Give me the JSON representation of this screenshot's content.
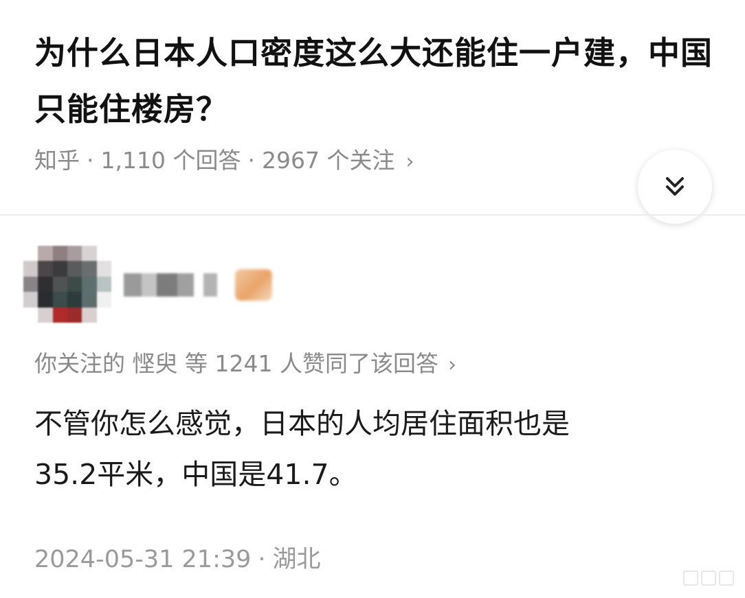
{
  "question": {
    "title": "为什么日本人口密度这么大还能住一户建，中国只能住楼房？",
    "source": "知乎",
    "answer_count": "1,110 个回答",
    "follow_count": "2967 个关注",
    "separator": "·",
    "chevron": "›"
  },
  "expand_button": {
    "icon": "double-chevron-down-icon"
  },
  "answer": {
    "upvote_prefix": "你关注的",
    "upvote_friend": "悭臾",
    "upvote_suffix": "等 1241 人赞同了该回答",
    "chevron": "›",
    "body_line1": "不管你怎么感觉，日本的人均居住面积也是",
    "body_line2": "35.2平米，中国是41.7。",
    "date": "2024-05-31 21:39",
    "separator": "·",
    "location": "湖北"
  },
  "colors": {
    "title": "#121212",
    "meta": "#8a8a8a",
    "body": "#1a1a1a",
    "divider": "#ececec"
  }
}
